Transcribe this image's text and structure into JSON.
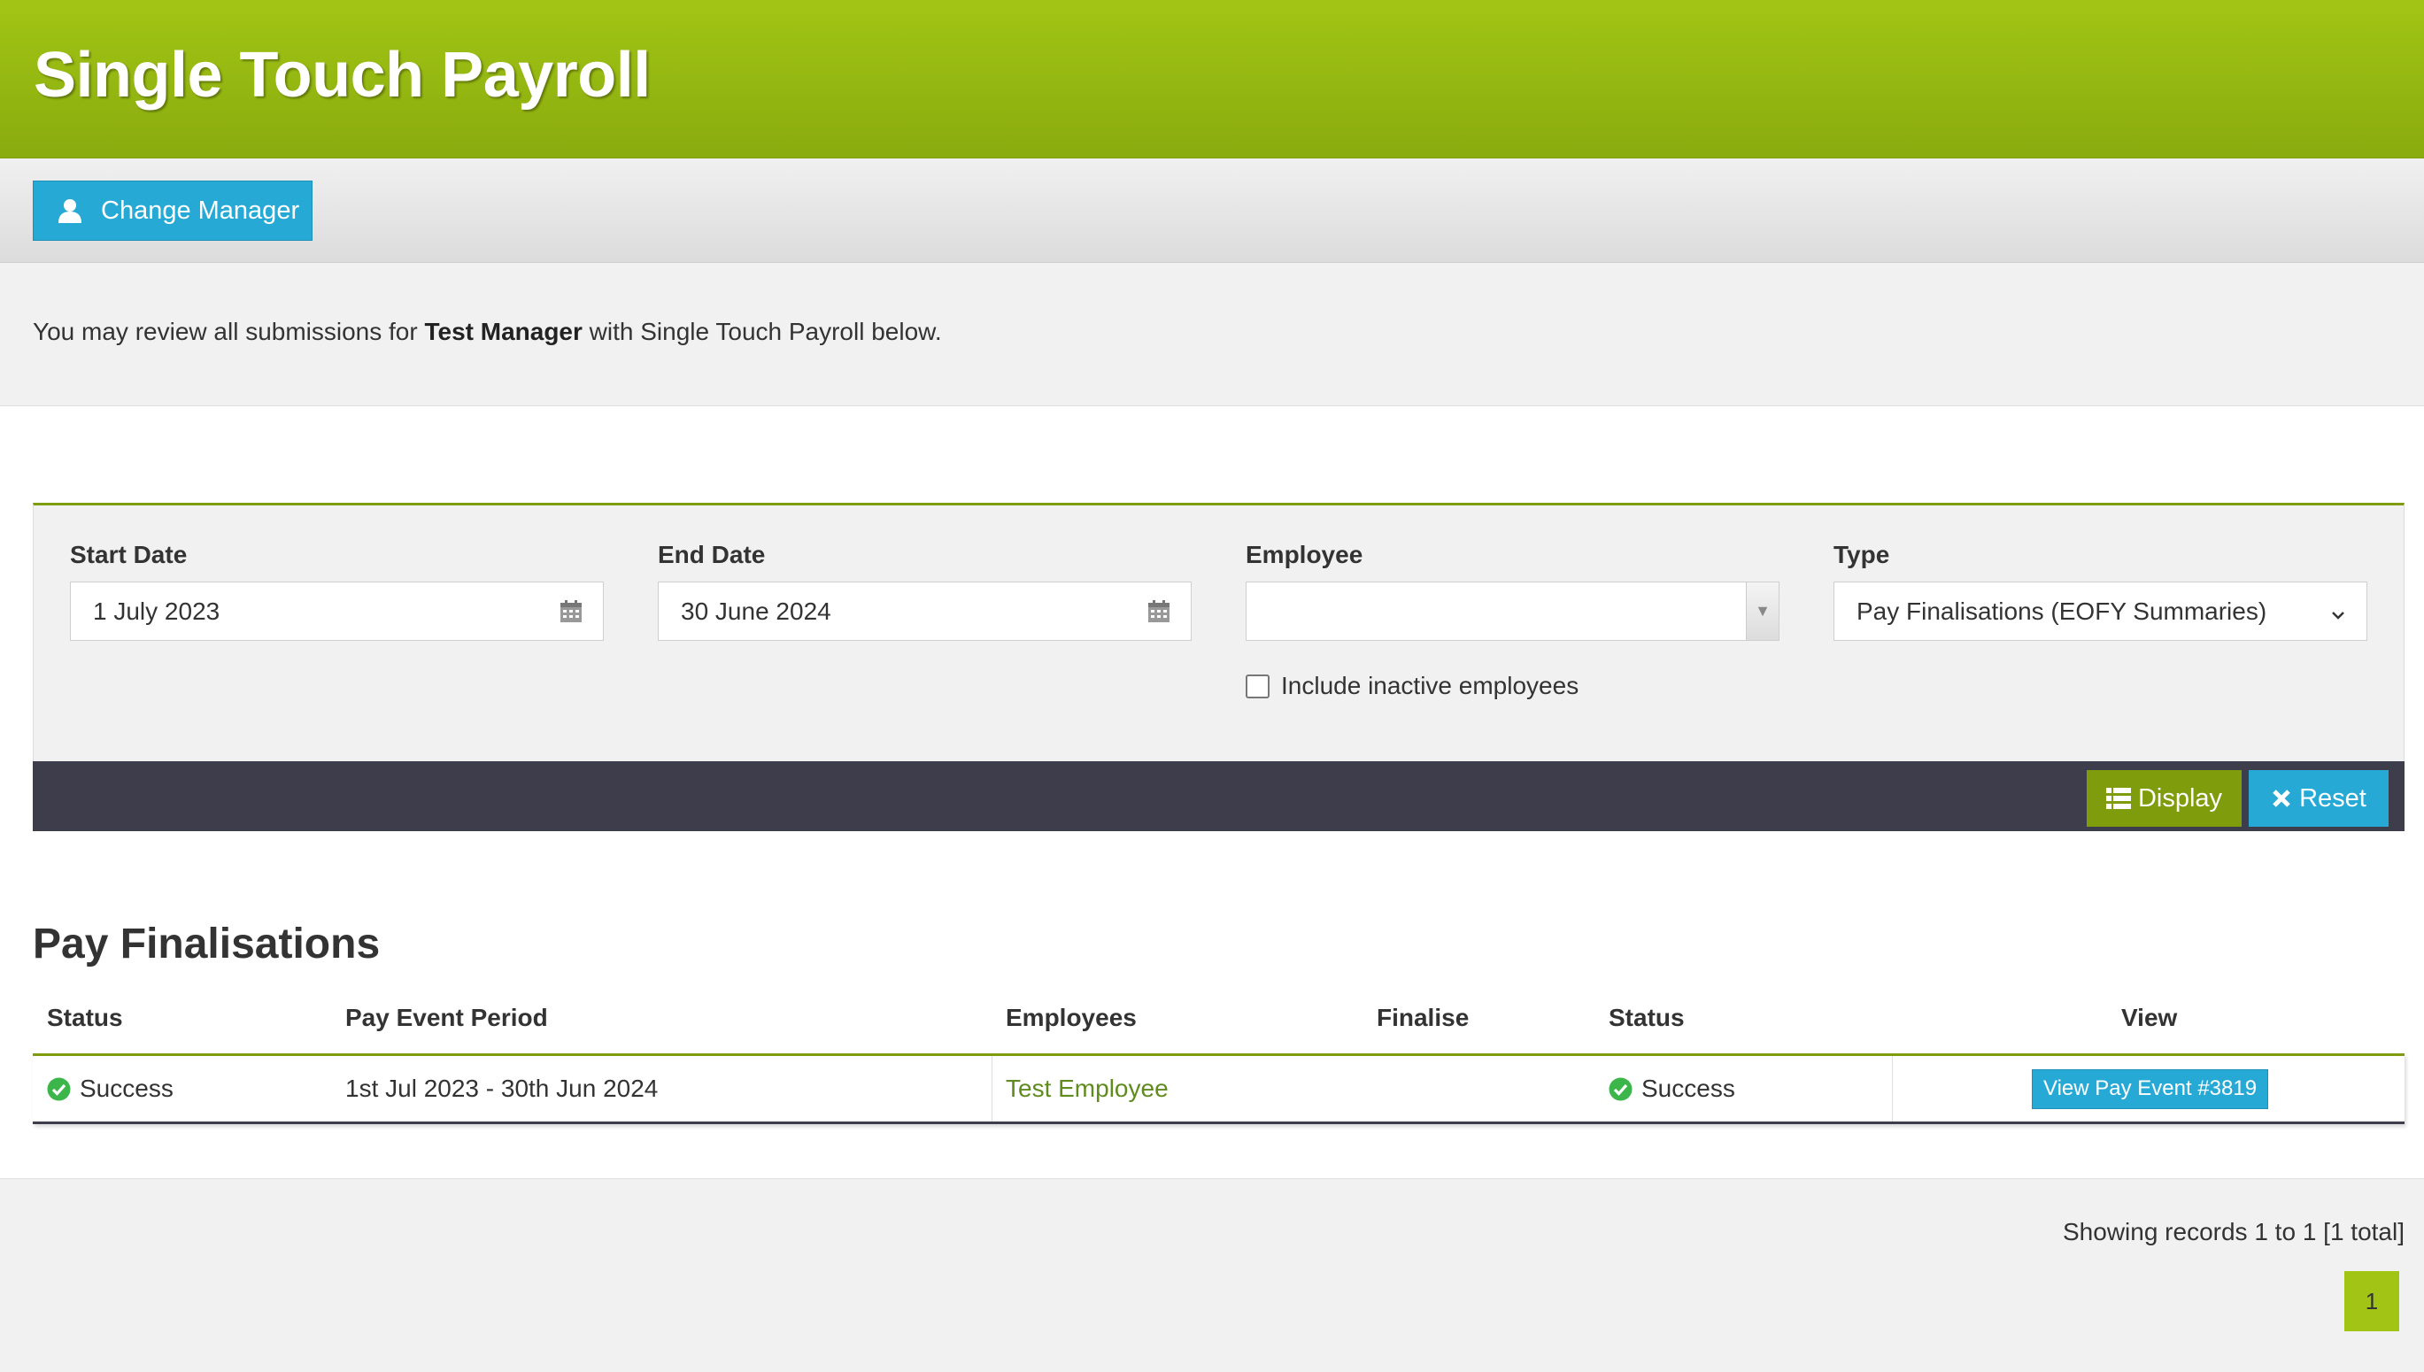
{
  "header": {
    "title": "Single Touch Payroll"
  },
  "toolbar": {
    "change_manager_label": "Change Manager"
  },
  "intro": {
    "prefix": "You may review all submissions for ",
    "manager": "Test Manager",
    "suffix": " with Single Touch Payroll below."
  },
  "filters": {
    "start_date": {
      "label": "Start Date",
      "value": "1 July 2023"
    },
    "end_date": {
      "label": "End Date",
      "value": "30 June 2024"
    },
    "employee": {
      "label": "Employee",
      "value": ""
    },
    "type": {
      "label": "Type",
      "value": "Pay Finalisations (EOFY Summaries)"
    },
    "include_inactive": {
      "label": "Include inactive employees",
      "checked": false
    },
    "display_label": "Display",
    "reset_label": "Reset"
  },
  "section": {
    "title": "Pay Finalisations"
  },
  "table": {
    "headers": [
      "Status",
      "Pay Event Period",
      "Employees",
      "Finalise",
      "Status",
      "View"
    ],
    "rows": [
      {
        "status": "Success",
        "period": "1st Jul 2023 - 30th Jun 2024",
        "employee": "Test Employee",
        "finalise": "",
        "status2": "Success",
        "view_label": "View Pay Event #3819"
      }
    ]
  },
  "pagination": {
    "summary": "Showing records 1 to 1 [1 total]",
    "current_page": "1"
  },
  "colors": {
    "brand_green": "#a2c515",
    "accent_blue": "#27a9d5",
    "dark_bar": "#3e3d4b",
    "olive": "#7e9c0b"
  }
}
